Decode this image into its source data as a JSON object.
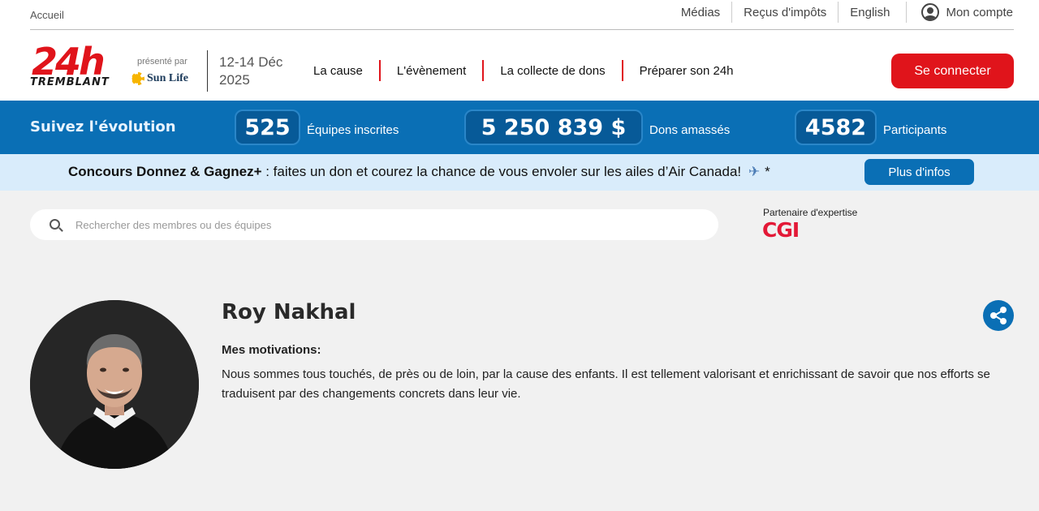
{
  "breadcrumb": "Accueil",
  "utility": {
    "medias": "Médias",
    "tax_receipts": "Reçus d'impôts",
    "language": "English",
    "account": "Mon compte"
  },
  "logo": {
    "number": "24h",
    "name": "TREMBLANT",
    "presented_by": "présenté par",
    "sponsor": "Sun Life"
  },
  "dates": {
    "line1": "12-14 Déc",
    "line2": "2025"
  },
  "nav": {
    "items": [
      "La cause",
      "L'évènement",
      "La collecte de dons",
      "Préparer son 24h"
    ],
    "login": "Se connecter"
  },
  "stats": {
    "title": "Suivez l'évolution",
    "teams_value": "525",
    "teams_label": "Équipes inscrites",
    "donations_value": "5 250 839 $",
    "donations_label": "Dons amassés",
    "participants_value": "4582",
    "participants_label": "Participants"
  },
  "contest": {
    "bold": "Concours Donnez & Gagnez+",
    "text": " : faites un don et courez la chance de vous envoler sur les ailes d’Air Canada!",
    "plane": "✈",
    "asterisk": "*",
    "button": "Plus d'infos"
  },
  "search": {
    "placeholder": "Rechercher des membres ou des équipes"
  },
  "partner": {
    "label": "Partenaire d'expertise",
    "logo_text": "CGI"
  },
  "profile": {
    "name": "Roy Nakhal",
    "motivations_label": "Mes motivations:",
    "motivations_text": "Nous sommes tous touchés, de près ou de loin, par la cause des enfants. Il est tellement valorisant et enrichissant de savoir que nos efforts se traduisent par des changements concrets dans leur vie."
  },
  "colors": {
    "brand_red": "#e0141b",
    "brand_blue": "#0a6fb5",
    "banner_light_blue": "#d9ecfb"
  }
}
